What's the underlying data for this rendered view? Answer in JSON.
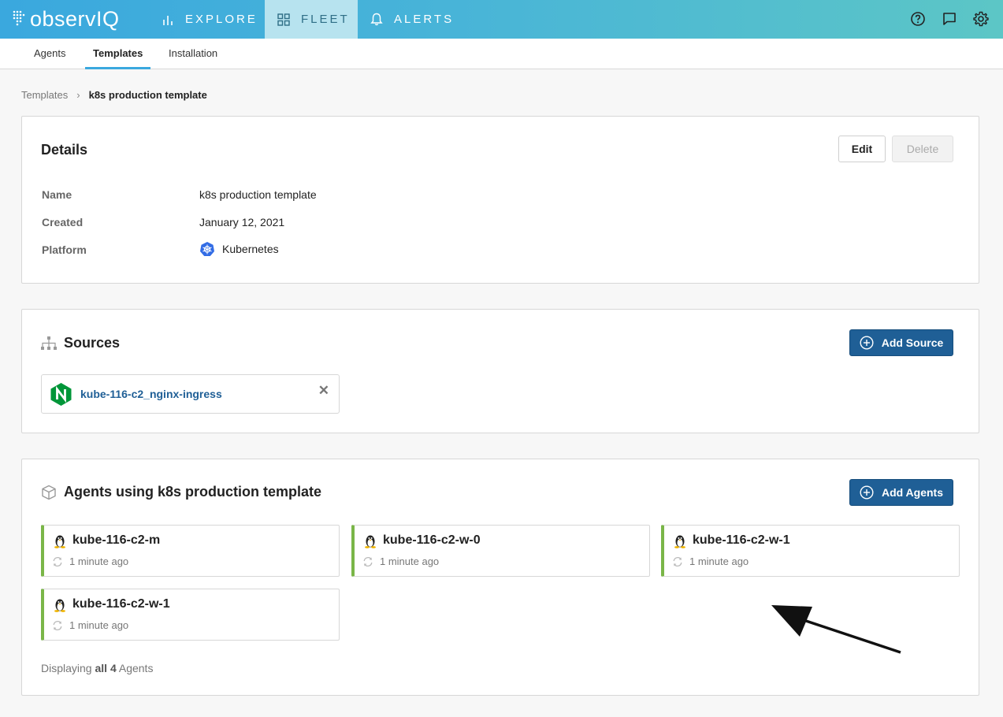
{
  "topbar": {
    "logo_text": "observIQ",
    "nav": [
      {
        "label": "EXPLORE",
        "icon": "bar-chart-icon"
      },
      {
        "label": "FLEET",
        "icon": "grid-icon",
        "active": true
      },
      {
        "label": "ALERTS",
        "icon": "bell-icon"
      }
    ],
    "right_icons": [
      "help-icon",
      "chat-icon",
      "settings-icon"
    ]
  },
  "subtabs": [
    {
      "label": "Agents"
    },
    {
      "label": "Templates",
      "active": true
    },
    {
      "label": "Installation"
    }
  ],
  "breadcrumb": {
    "parent": "Templates",
    "separator": "›",
    "current": "k8s production template"
  },
  "details": {
    "title": "Details",
    "edit_label": "Edit",
    "delete_label": "Delete",
    "fields": [
      {
        "label": "Name",
        "value": "k8s production template"
      },
      {
        "label": "Created",
        "value": "January 12, 2021"
      },
      {
        "label": "Platform",
        "value": "Kubernetes",
        "icon": "kubernetes-icon"
      }
    ]
  },
  "sources": {
    "title": "Sources",
    "add_label": "Add Source",
    "items": [
      {
        "name": "kube-116-c2_nginx-ingress",
        "icon": "nginx-icon"
      }
    ]
  },
  "agents": {
    "title": "Agents using k8s production template",
    "add_label": "Add Agents",
    "items": [
      {
        "name": "kube-116-c2-m",
        "status": "1 minute ago",
        "os_icon": "linux-icon"
      },
      {
        "name": "kube-116-c2-w-0",
        "status": "1 minute ago",
        "os_icon": "linux-icon"
      },
      {
        "name": "kube-116-c2-w-1",
        "status": "1 minute ago",
        "os_icon": "linux-icon"
      },
      {
        "name": "kube-116-c2-w-1",
        "status": "1 minute ago",
        "os_icon": "linux-icon"
      }
    ],
    "footer_prefix": "Displaying ",
    "footer_bold": "all 4",
    "footer_suffix": " Agents"
  },
  "colors": {
    "accent": "#3aa8de",
    "primary_button": "#1f5f96",
    "agent_status_bar": "#7ab648"
  }
}
